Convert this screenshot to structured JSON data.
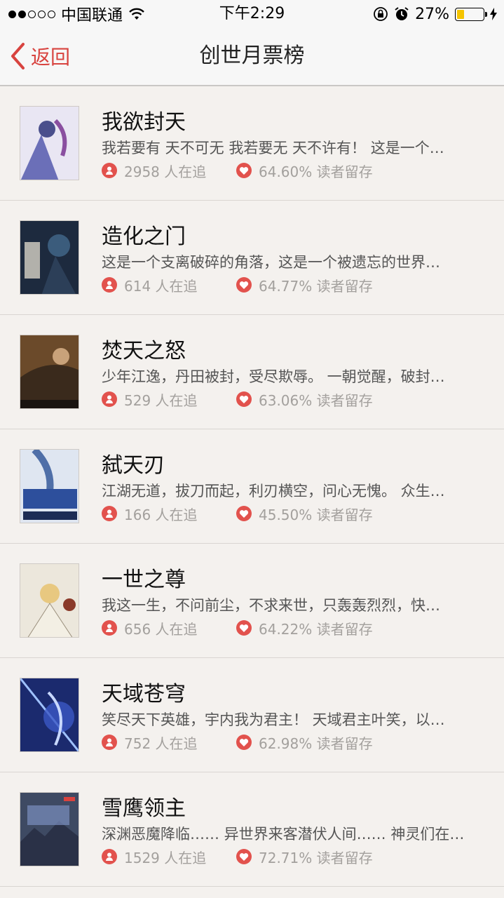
{
  "status_bar": {
    "carrier": "中国联通",
    "time": "下午2:29",
    "battery": "27%",
    "battery_level": 0.27,
    "signal_dots_filled": 2,
    "signal_dots_total": 5
  },
  "nav": {
    "back_label": "返回",
    "title": "创世月票榜"
  },
  "colors": {
    "accent": "#d8433f",
    "background": "#f4f1ee",
    "battery": "#f5c400"
  },
  "icons": {
    "followers": "person-icon",
    "retention": "heart-icon"
  },
  "books": [
    {
      "title": "我欲封天",
      "desc": "我若要有 天不可无 我若要无 天不许有！ 这是一个…",
      "followers": "2958 人在追",
      "retention": "64.60% 读者留存"
    },
    {
      "title": "造化之门",
      "desc": "这是一个支离破碎的角落，这是一个被遗忘的世界…",
      "followers": "614 人在追",
      "retention": "64.77% 读者留存"
    },
    {
      "title": "焚天之怒",
      "desc": "少年江逸，丹田被封，受尽欺辱。 一朝觉醒，破封…",
      "followers": "529 人在追",
      "retention": "63.06% 读者留存"
    },
    {
      "title": "弑天刃",
      "desc": "江湖无道，拔刀而起，利刃横空，问心无愧。 众生…",
      "followers": "166 人在追",
      "retention": "45.50% 读者留存"
    },
    {
      "title": "一世之尊",
      "desc": "我这一生，不问前尘，不求来世，只轰轰烈烈，快…",
      "followers": "656 人在追",
      "retention": "64.22% 读者留存"
    },
    {
      "title": "天域苍穹",
      "desc": "笑尽天下英雄，宇内我为君主！ 天域君主叶笑，以…",
      "followers": "752 人在追",
      "retention": "62.98% 读者留存"
    },
    {
      "title": "雪鹰领主",
      "desc": "深渊恶魔降临…… 异世界来客潜伏人间…… 神灵们在…",
      "followers": "1529 人在追",
      "retention": "72.71% 读者留存"
    }
  ]
}
